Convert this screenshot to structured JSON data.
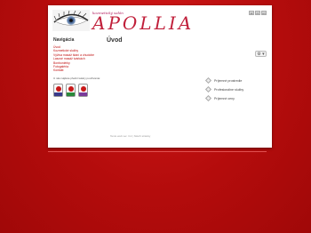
{
  "header": {
    "tagline": "kozmetický salón",
    "logo": "APOLLIA",
    "lang_buttons": [
      "sk",
      "cz",
      "en"
    ]
  },
  "sidebar": {
    "title": "Navigácia",
    "items": [
      "Úvod",
      "Kozmetické služby",
      "Výživa masáž tkání a chudobe",
      "Lasové masáž tvárkách",
      "Bonboniérky",
      "Fotogaléria",
      "Kontakt"
    ],
    "note": "U nás nájdete přední lekáry používania:",
    "badges": [
      "badge-1",
      "badge-2",
      "badge-3"
    ]
  },
  "main": {
    "title": "Úvod",
    "settings_label": "⚙ ▾",
    "features": [
      "Príjemné prostredie",
      "Profesionálne služby",
      "Príjemné ceny"
    ]
  },
  "footer": {
    "text": "Tento web ver. 3.2 | Návrh stránky"
  },
  "colors": {
    "background": "#b80d0d",
    "accent": "#c01f3a",
    "link": "#c01010"
  }
}
